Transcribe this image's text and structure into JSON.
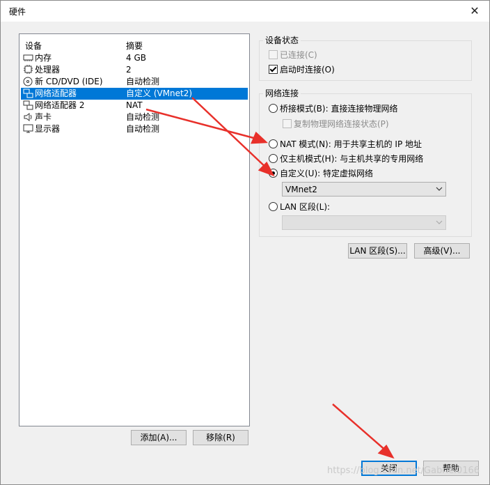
{
  "window": {
    "title": "硬件",
    "close_glyph": "✕"
  },
  "device_list": {
    "headers": {
      "device": "设备",
      "summary": "摘要"
    },
    "items": [
      {
        "name": "内存",
        "summary": "4 GB",
        "icon": "memory-icon"
      },
      {
        "name": "处理器",
        "summary": "2",
        "icon": "cpu-icon"
      },
      {
        "name": "新 CD/DVD (IDE)",
        "summary": "自动检测",
        "icon": "cd-dvd-icon"
      },
      {
        "name": "网络适配器",
        "summary": "自定义 (VMnet2)",
        "icon": "network-adapter-icon",
        "selected": true
      },
      {
        "name": "网络适配器 2",
        "summary": "NAT",
        "icon": "network-adapter-icon"
      },
      {
        "name": "声卡",
        "summary": "自动检测",
        "icon": "speaker-icon"
      },
      {
        "name": "显示器",
        "summary": "自动检测",
        "icon": "monitor-icon"
      }
    ]
  },
  "list_buttons": {
    "add": "添加(A)...",
    "remove": "移除(R)"
  },
  "device_status": {
    "label": "设备状态",
    "connected": {
      "label": "已连接(C)",
      "checked": false,
      "disabled": true
    },
    "connect_on_power": {
      "label": "启动时连接(O)",
      "checked": true
    }
  },
  "network_connection": {
    "label": "网络连接",
    "bridged": {
      "label": "桥接模式(B): 直接连接物理网络",
      "selected": false
    },
    "replicate": {
      "label": "复制物理网络连接状态(P)",
      "checked": false,
      "disabled": true
    },
    "nat": {
      "label": "NAT 模式(N): 用于共享主机的 IP 地址",
      "selected": false
    },
    "host_only": {
      "label": "仅主机模式(H): 与主机共享的专用网络",
      "selected": false
    },
    "custom": {
      "label": "自定义(U): 特定虚拟网络",
      "selected": true
    },
    "custom_value": "VMnet2",
    "lan_segment": {
      "label": "LAN 区段(L):",
      "selected": false
    },
    "lan_value": ""
  },
  "side_buttons": {
    "lan_segments": "LAN 区段(S)...",
    "advanced": "高级(V)..."
  },
  "footer_buttons": {
    "close": "关闭",
    "help": "帮助"
  },
  "watermark": "https://blog.csdn.net/Gabriel0166",
  "colors": {
    "selection": "#0078d7",
    "annotation_arrow": "#e8302a"
  }
}
